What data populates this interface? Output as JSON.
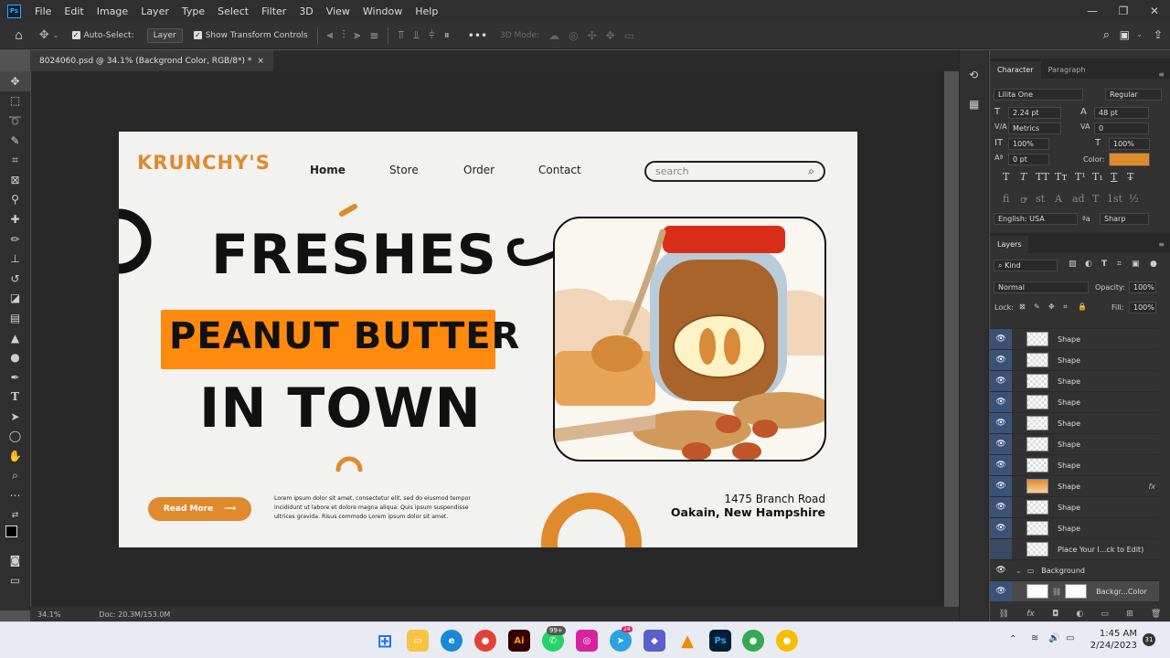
{
  "app": {
    "logo_text": "Ps"
  },
  "menu": [
    "File",
    "Edit",
    "Image",
    "Layer",
    "Type",
    "Select",
    "Filter",
    "3D",
    "View",
    "Window",
    "Help"
  ],
  "window_controls": {
    "minimize": "—",
    "restore": "❐",
    "close": "✕"
  },
  "options": {
    "auto_select_label": "Auto-Select:",
    "auto_select_value": "Layer",
    "transform_label": "Show Transform Controls",
    "mode_3d_label": "3D Mode:",
    "more": "•••"
  },
  "document": {
    "tab_title": "8024060.psd @ 34.1% (Backgrond Color, RGB/8*) *",
    "tab_close": "×"
  },
  "status": {
    "zoom": "34.1%",
    "doc_size": "Doc: 20.3M/153.0M"
  },
  "character_panel": {
    "tabs": [
      "Character",
      "Paragraph"
    ],
    "font_family": "Lilita One",
    "font_style": "Regular",
    "size": "2.24 pt",
    "leading": "48 pt",
    "kerning": "Metrics",
    "tracking": "0",
    "vscale": "100%",
    "hscale": "100%",
    "baseline": "0 pt",
    "color_label": "Color:",
    "color": "#e08a2e",
    "language": "English: USA",
    "aa_label": "ªa",
    "antialias": "Sharp",
    "style_glyphs": [
      "T",
      "T",
      "TT",
      "Tт",
      "T¹",
      "T₁",
      "T",
      "T̶"
    ],
    "ot_glyphs": [
      "fi",
      "ꝍ",
      "st",
      "A",
      "ad",
      "T",
      "1st",
      "½"
    ]
  },
  "layers_panel": {
    "title": "Layers",
    "kind_label": "Kind",
    "blend_mode": "Normal",
    "opacity_label": "Opacity:",
    "opacity": "100%",
    "lock_label": "Lock:",
    "fill_label": "Fill:",
    "fill": "100%",
    "layers": [
      {
        "name": "Shape",
        "fx": ""
      },
      {
        "name": "Shape",
        "fx": ""
      },
      {
        "name": "Shape",
        "fx": ""
      },
      {
        "name": "Shape",
        "fx": ""
      },
      {
        "name": "Shape",
        "fx": ""
      },
      {
        "name": "Shape",
        "fx": ""
      },
      {
        "name": "Shape",
        "fx": ""
      },
      {
        "name": "Shape",
        "fx": "fx"
      },
      {
        "name": "Shape",
        "fx": ""
      },
      {
        "name": "Shape",
        "fx": ""
      },
      {
        "name": "Place Your I...ck to Edit)",
        "fx": ""
      }
    ],
    "group_name": "Background",
    "bg_layer": "Backgr...Color"
  },
  "artboard": {
    "brand": "KRUNCHY'S",
    "nav": [
      "Home",
      "Store",
      "Order",
      "Contact"
    ],
    "search_placeholder": "search",
    "headline1": "FRESHES",
    "headline2": "PEANUT BUTTER",
    "headline3": "IN TOWN",
    "cta": "Read More",
    "cta_arrow": "⟶",
    "body_text": [
      "Lorem ipsum dolor sit amet, consectetur elit, sed do eiusmod tempor",
      "incididunt ut labore et dolore magna aliqua. Quis ipsum suspendisse",
      "ultrices gravida. Risus commodo Lorem ipsum dolor sit amet."
    ],
    "address1": "1475 Branch Road",
    "address2": "Oakain, New Hampshire",
    "accent": "#e08a2e",
    "highlight": "#ff8a0d"
  },
  "taskbar": {
    "time": "1:45 AM",
    "date": "2/24/2023",
    "notif": "31",
    "whatsapp_badge": "99+",
    "telegram_badge": "24",
    "ai_label": "Ai",
    "ps_label": "Ps"
  }
}
